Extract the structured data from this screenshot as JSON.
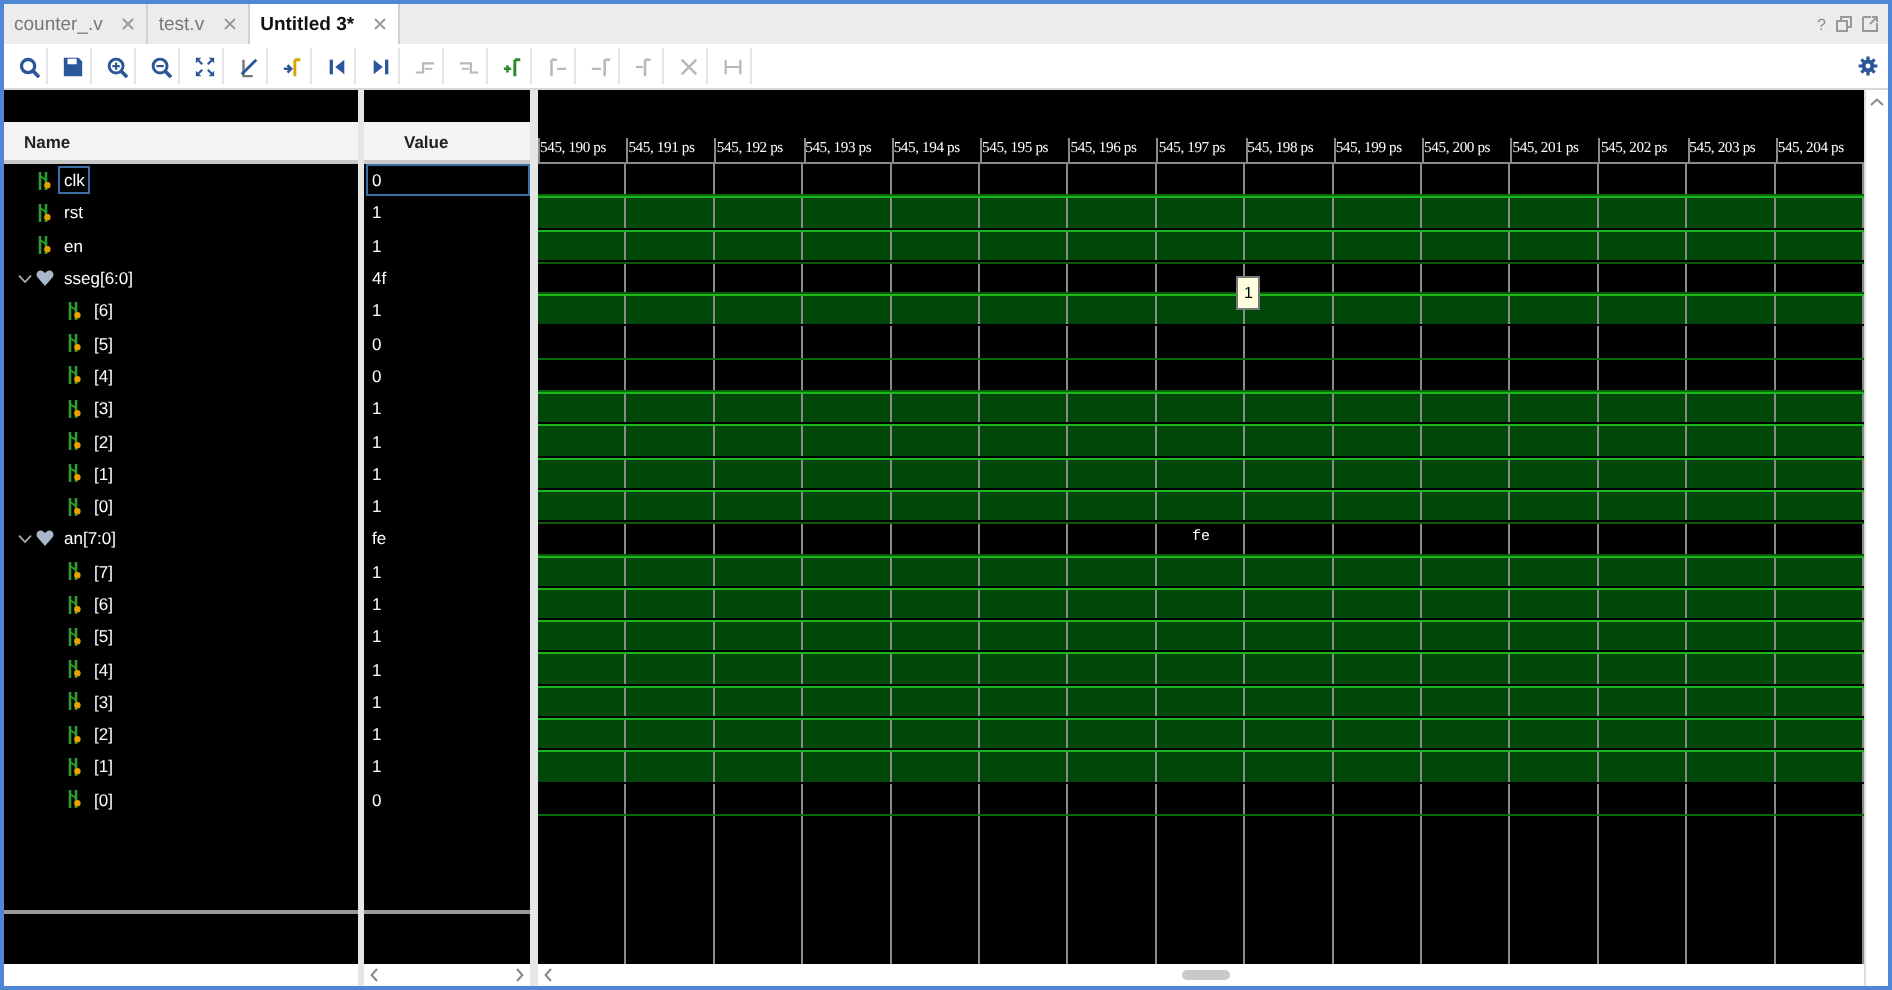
{
  "tabs": [
    {
      "label": "counter_.v",
      "selected": false
    },
    {
      "label": "test.v",
      "selected": false
    },
    {
      "label": "Untitled 3*",
      "selected": true
    }
  ],
  "window_controls": {
    "help": "?"
  },
  "toolbar": [
    {
      "kind": "search",
      "disabled": false
    },
    {
      "kind": "save",
      "disabled": false
    },
    {
      "kind": "zoom-in",
      "disabled": false
    },
    {
      "kind": "zoom-out",
      "disabled": false
    },
    {
      "kind": "fit",
      "disabled": false
    },
    {
      "kind": "swap",
      "disabled": false
    },
    {
      "kind": "go-marker",
      "disabled": false
    },
    {
      "kind": "first",
      "disabled": false
    },
    {
      "kind": "last",
      "disabled": false
    },
    {
      "kind": "prev-edge",
      "disabled": true
    },
    {
      "kind": "next-edge",
      "disabled": true
    },
    {
      "kind": "add-marker",
      "disabled": false
    },
    {
      "kind": "prev-marker",
      "disabled": true
    },
    {
      "kind": "next-marker",
      "disabled": true
    },
    {
      "kind": "marker",
      "disabled": true
    },
    {
      "kind": "delete",
      "disabled": true
    },
    {
      "kind": "bracket",
      "disabled": true
    }
  ],
  "columns": {
    "name": "Name",
    "value": "Value"
  },
  "timeline": [
    "545, 190 ps",
    "545, 191 ps",
    "545, 192 ps",
    "545, 193 ps",
    "545, 194 ps",
    "545, 195 ps",
    "545, 196 ps",
    "545, 197 ps",
    "545, 198 ps",
    "545, 199 ps",
    "545, 200 ps",
    "545, 201 ps",
    "545, 202 ps",
    "545, 203 ps",
    "545, 204 ps"
  ],
  "signals": [
    {
      "name": "clk",
      "kind": "bit",
      "value": "0",
      "high": false,
      "selected": true
    },
    {
      "name": "rst",
      "kind": "bit",
      "value": "1",
      "high": true,
      "selected": false
    },
    {
      "name": "en",
      "kind": "bit",
      "value": "1",
      "high": true,
      "selected": false
    },
    {
      "name": "sseg[6:0]",
      "kind": "bus",
      "value": "4f",
      "expanded": true,
      "selected": false,
      "children": [
        {
          "name": "[6]",
          "kind": "bit",
          "value": "1",
          "high": true,
          "selected": false
        },
        {
          "name": "[5]",
          "kind": "bit",
          "value": "0",
          "high": false,
          "selected": false
        },
        {
          "name": "[4]",
          "kind": "bit",
          "value": "0",
          "high": false,
          "selected": false
        },
        {
          "name": "[3]",
          "kind": "bit",
          "value": "1",
          "high": true,
          "selected": false
        },
        {
          "name": "[2]",
          "kind": "bit",
          "value": "1",
          "high": true,
          "selected": false
        },
        {
          "name": "[1]",
          "kind": "bit",
          "value": "1",
          "high": true,
          "selected": false
        },
        {
          "name": "[0]",
          "kind": "bit",
          "value": "1",
          "high": true,
          "selected": false
        }
      ]
    },
    {
      "name": "an[7:0]",
      "kind": "bus",
      "value": "fe",
      "wave_label": "fe",
      "expanded": true,
      "selected": false,
      "children": [
        {
          "name": "[7]",
          "kind": "bit",
          "value": "1",
          "high": true,
          "selected": false
        },
        {
          "name": "[6]",
          "kind": "bit",
          "value": "1",
          "high": true,
          "selected": false
        },
        {
          "name": "[5]",
          "kind": "bit",
          "value": "1",
          "high": true,
          "selected": false
        },
        {
          "name": "[4]",
          "kind": "bit",
          "value": "1",
          "high": true,
          "selected": false
        },
        {
          "name": "[3]",
          "kind": "bit",
          "value": "1",
          "high": true,
          "selected": false
        },
        {
          "name": "[2]",
          "kind": "bit",
          "value": "1",
          "high": true,
          "selected": false
        },
        {
          "name": "[1]",
          "kind": "bit",
          "value": "1",
          "high": true,
          "selected": false
        },
        {
          "name": "[0]",
          "kind": "bit",
          "value": "0",
          "high": false,
          "selected": false
        }
      ]
    }
  ],
  "cursor_tooltip": "1"
}
